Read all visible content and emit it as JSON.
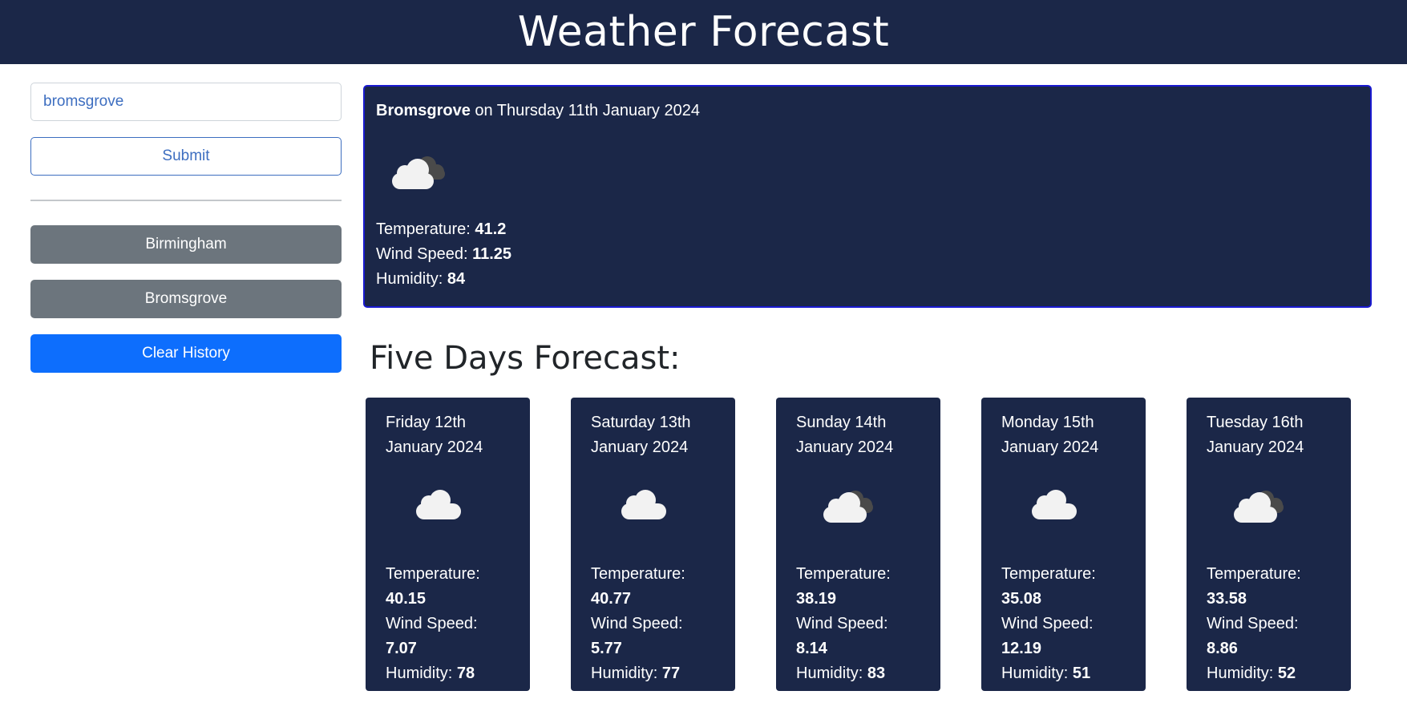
{
  "header": {
    "title": "Weather Forecast"
  },
  "search": {
    "value": "bromsgrove",
    "submit_label": "Submit"
  },
  "history": {
    "items": [
      {
        "label": "Birmingham"
      },
      {
        "label": "Bromsgrove"
      }
    ],
    "clear_label": "Clear History"
  },
  "current": {
    "city": "Bromsgrove",
    "date_text": " on Thursday 11th January 2024",
    "icon": "scattered-clouds-icon",
    "temperature_label": "Temperature: ",
    "temperature": "41.2",
    "wind_label": "Wind Speed: ",
    "wind": "11.25",
    "humidity_label": "Humidity: ",
    "humidity": "84"
  },
  "forecast": {
    "heading": "Five Days Forecast:",
    "temperature_label": "Temperature:",
    "wind_label": "Wind Speed:",
    "humidity_label": "Humidity: ",
    "days": [
      {
        "date_line1": "Friday 12th",
        "date_line2": "January 2024",
        "icon": "cloud-icon",
        "temperature": "40.15",
        "wind": "7.07",
        "humidity": "78"
      },
      {
        "date_line1": "Saturday 13th",
        "date_line2": "January 2024",
        "icon": "cloud-icon",
        "temperature": "40.77",
        "wind": "5.77",
        "humidity": "77"
      },
      {
        "date_line1": "Sunday 14th",
        "date_line2": "January 2024",
        "icon": "scattered-clouds-icon",
        "temperature": "38.19",
        "wind": "8.14",
        "humidity": "83"
      },
      {
        "date_line1": "Monday 15th",
        "date_line2": "January 2024",
        "icon": "cloud-icon",
        "temperature": "35.08",
        "wind": "12.19",
        "humidity": "51"
      },
      {
        "date_line1": "Tuesday 16th",
        "date_line2": "January 2024",
        "icon": "scattered-clouds-icon",
        "temperature": "33.58",
        "wind": "8.86",
        "humidity": "52"
      }
    ]
  },
  "colors": {
    "header_bg": "#1b2748",
    "card_bg": "#1b2748",
    "primary": "#0d6efd",
    "secondary": "#6c757d",
    "outline": "#3d6ec0"
  }
}
